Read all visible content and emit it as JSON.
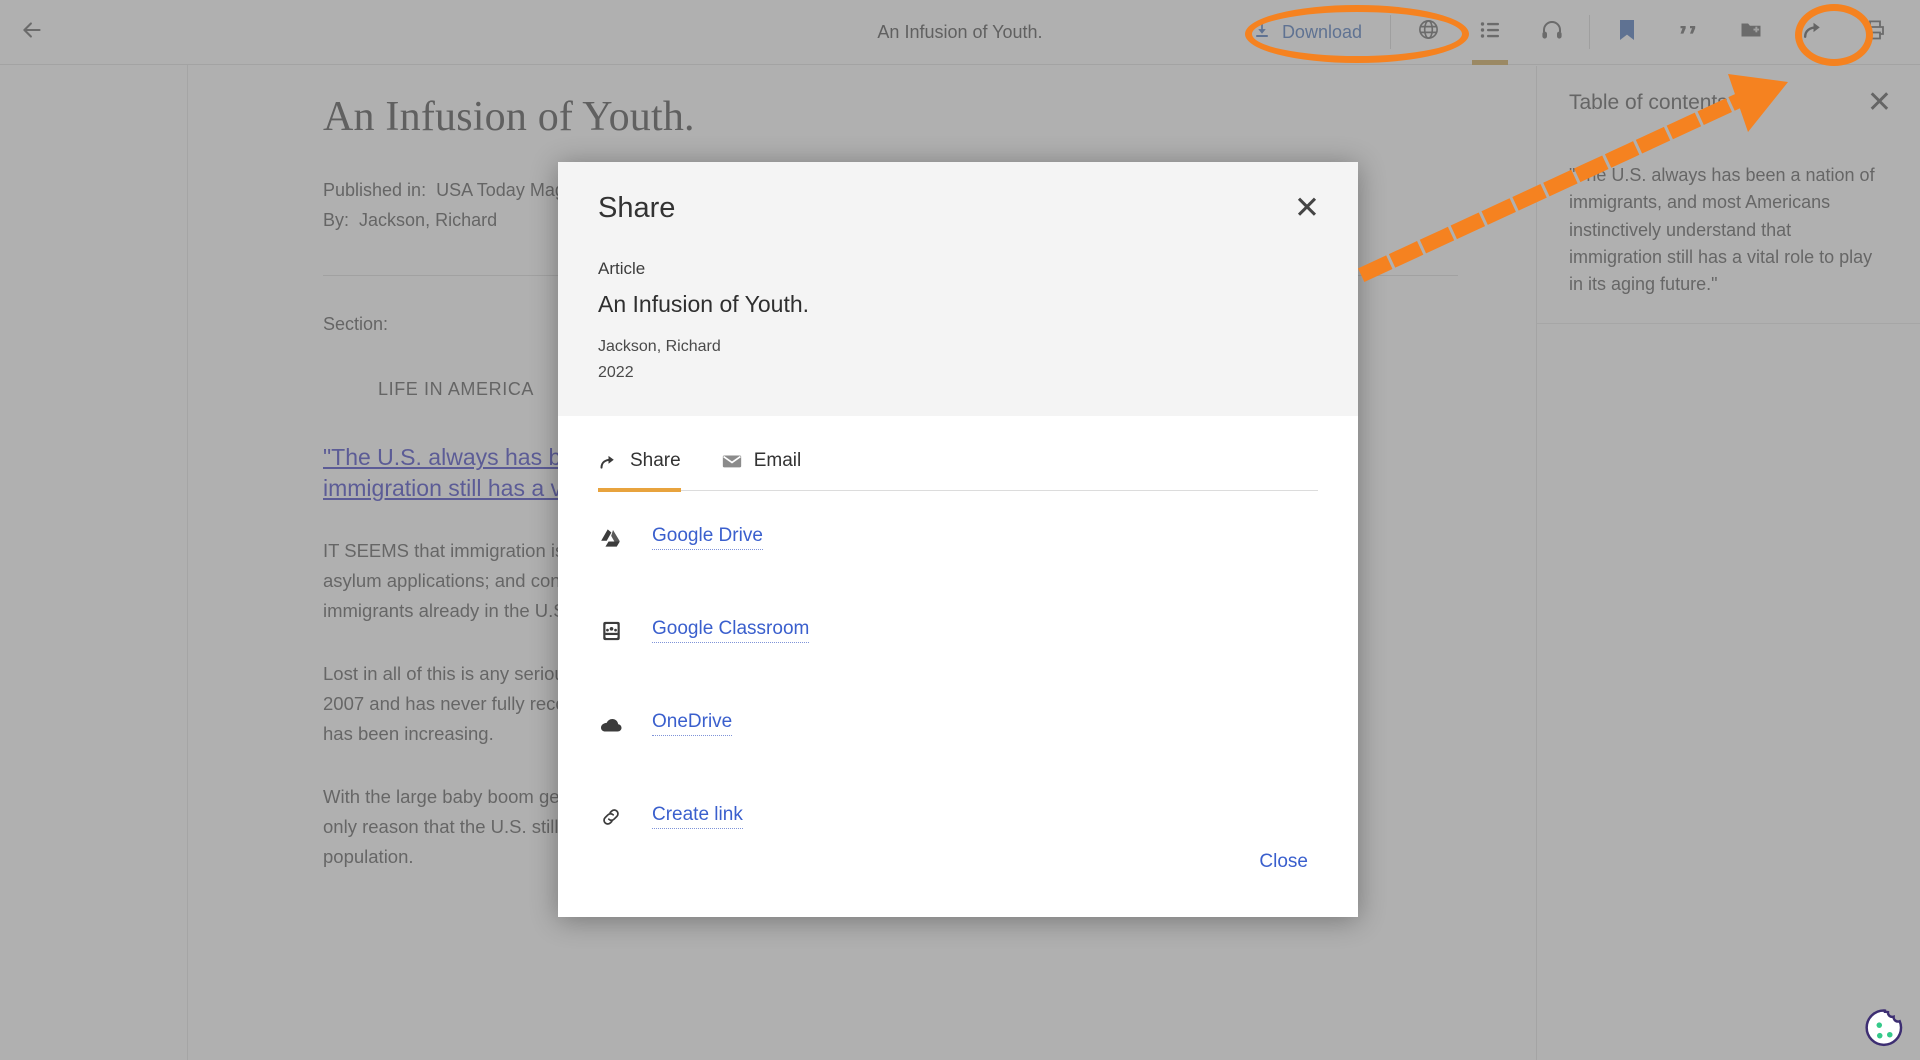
{
  "toolbar": {
    "back_icon": "arrow-left-icon",
    "title": "An Infusion of Youth.",
    "download_label": "Download",
    "download_icon": "download-icon",
    "icons": [
      {
        "name": "translate-globe-icon",
        "label": "Translate",
        "active": false
      },
      {
        "name": "table-of-contents-icon",
        "label": "Table of contents",
        "active": true
      },
      {
        "name": "listen-headphones-icon",
        "label": "Listen",
        "active": false
      },
      {
        "name": "bookmark-icon",
        "label": "Save",
        "active": false
      },
      {
        "name": "cite-quote-icon",
        "label": "Cite",
        "active": false
      },
      {
        "name": "add-to-folder-icon",
        "label": "Add to folder",
        "active": false
      },
      {
        "name": "share-arrow-icon",
        "label": "Share",
        "active": false
      },
      {
        "name": "print-icon",
        "label": "Print",
        "active": false
      }
    ]
  },
  "article": {
    "title": "An Infusion of Youth.",
    "published_in_label": "Published in:",
    "published_in_value": "USA Today Magazine",
    "by_label": "By:",
    "by_value": "Jackson, Richard",
    "section_label": "Section:",
    "section_name": "LIFE IN AMERICA",
    "pull_quote": "\"The U.S. always has been a nation of immigrants, and most Americans instinctively understand that immigration still has a vital role to play in its aging future.\"",
    "paragraphs": [
      "IT SEEMS that immigration is back in the headlines: triggered by the surge in unauthorized border crossings; the backlog in asylum applications; and contentious disagreements over how best (or even whether) to integrate the millions of unauthorized immigrants already in the U.S.",
      "Lost in all of this is any serious discussion or debate that net immigration has fallen sharply since its peak year from 1990-2007 and has never fully recovered. Moreover, even as immigration has been declining, its importance to economic growth has been increasing.",
      "With the large baby boom generation retiring and relatively smaller generations taking its place, immigration already is the only reason that the U.S. still has a growing workforce. By the 2040s, it will be the only reason that the U.S. still has a growing population."
    ]
  },
  "table_of_contents": {
    "title": "Table of contents",
    "close_icon": "close-icon",
    "entries": [
      "\"The U.S. always has been a nation of immigrants, and most Americans instinctively understand that immigration still has a vital role to play in its aging future.\""
    ]
  },
  "share_modal": {
    "heading": "Share",
    "close_icon": "close-icon",
    "kind": "Article",
    "doc_title": "An Infusion of Youth.",
    "author": "Jackson, Richard",
    "year": "2022",
    "tabs": [
      {
        "label": "Share",
        "icon": "share-arrow-icon",
        "active": true
      },
      {
        "label": "Email",
        "icon": "envelope-icon",
        "active": false
      }
    ],
    "destinations": [
      {
        "label": "Google Drive",
        "icon": "google-drive-icon"
      },
      {
        "label": "Google Classroom",
        "icon": "google-classroom-icon"
      },
      {
        "label": "OneDrive",
        "icon": "onedrive-cloud-icon"
      },
      {
        "label": "Create link",
        "icon": "link-chain-icon"
      }
    ],
    "close_button": "Close"
  },
  "annotations": {
    "highlight_color": "#F58220",
    "items": [
      {
        "name": "download-button-highlight",
        "shape": "ellipse"
      },
      {
        "name": "share-button-highlight",
        "shape": "ellipse"
      },
      {
        "name": "toc-pointer-arrow",
        "shape": "dashed-arrow"
      }
    ]
  },
  "cookie_widget": {
    "icon": "cookie-consent-icon"
  },
  "colors": {
    "accent_gold": "#c79a37",
    "tab_underline": "#e8a33d",
    "link_blue": "#3a5fcd",
    "quote_link": "#2222bb",
    "annotation_orange": "#F58220"
  }
}
